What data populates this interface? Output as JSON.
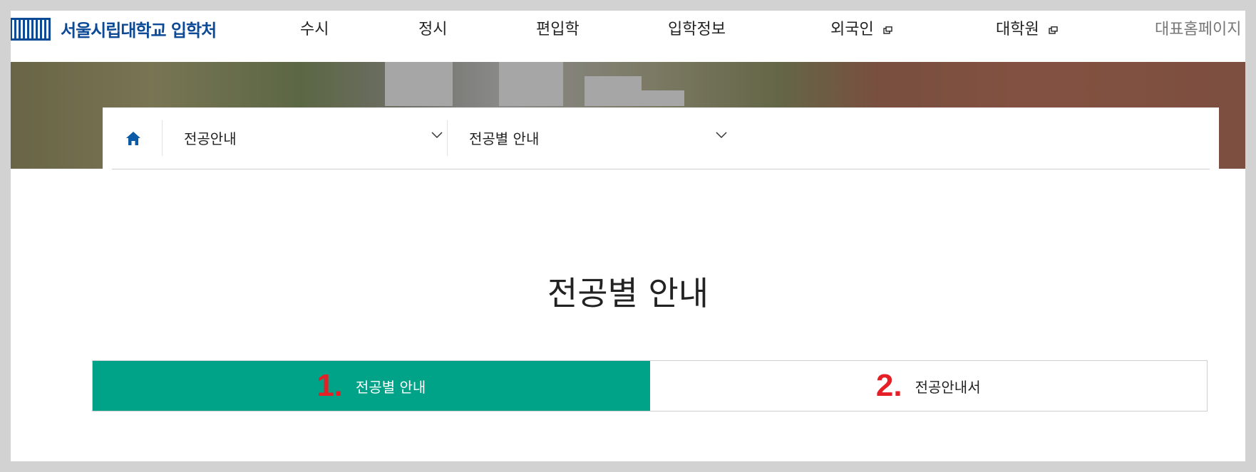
{
  "header": {
    "logo_text": "서울시립대학교 입학처",
    "nav": [
      {
        "label": "수시",
        "external": false
      },
      {
        "label": "정시",
        "external": false
      },
      {
        "label": "편입학",
        "external": false
      },
      {
        "label": "입학정보",
        "external": false
      },
      {
        "label": "외국인",
        "external": true
      },
      {
        "label": "대학원",
        "external": true
      }
    ],
    "home_link": "대표홈페이지"
  },
  "location": {
    "home_icon": "home-icon",
    "crumbs": [
      {
        "label": "전공안내"
      },
      {
        "label": "전공별 안내"
      }
    ]
  },
  "page": {
    "title": "전공별 안내"
  },
  "tabs": [
    {
      "number": "1.",
      "label": "전공별 안내",
      "active": true
    },
    {
      "number": "2.",
      "label": "전공안내서",
      "active": false
    }
  ],
  "colors": {
    "brand": "#0c4a96",
    "tab_active": "#00a387",
    "annotation_red": "#e51f25"
  }
}
